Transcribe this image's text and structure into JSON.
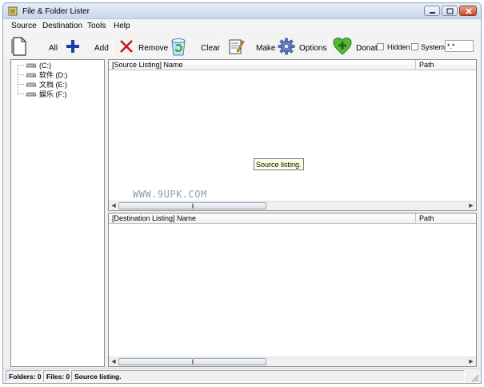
{
  "window": {
    "title": "File & Folder Lister"
  },
  "menu": {
    "items": [
      "Source",
      "Destination",
      "Tools",
      "Help"
    ]
  },
  "toolbar": {
    "all_label": "All",
    "add_label": "Add",
    "remove_label": "Remove",
    "clear_label": "Clear",
    "make_label": "Make",
    "options_label": "Options",
    "donate_label": "Donat",
    "hidden_label": "Hidden",
    "system_label": "System",
    "filter_value": "*.*"
  },
  "tree": {
    "drives": [
      {
        "label": "(C:)"
      },
      {
        "label": "软件 (D:)"
      },
      {
        "label": "文档 (E:)"
      },
      {
        "label": "娱乐 (F:)"
      }
    ]
  },
  "source_pane": {
    "col_name": "[Source Listing] Name",
    "col_path": "Path",
    "tooltip": "Source listing."
  },
  "destination_pane": {
    "col_name": "[Destination Listing] Name",
    "col_path": "Path"
  },
  "watermark": "WWW.9UPK.COM",
  "status": {
    "folders": "Folders: 0",
    "files": "Files: 0",
    "message": "Source listing."
  },
  "colors": {
    "accent_blue": "#1a3ea3",
    "remove_red": "#c21a1a",
    "donate_green": "#3fa52c",
    "tooltip_bg": "#ffffe1"
  }
}
